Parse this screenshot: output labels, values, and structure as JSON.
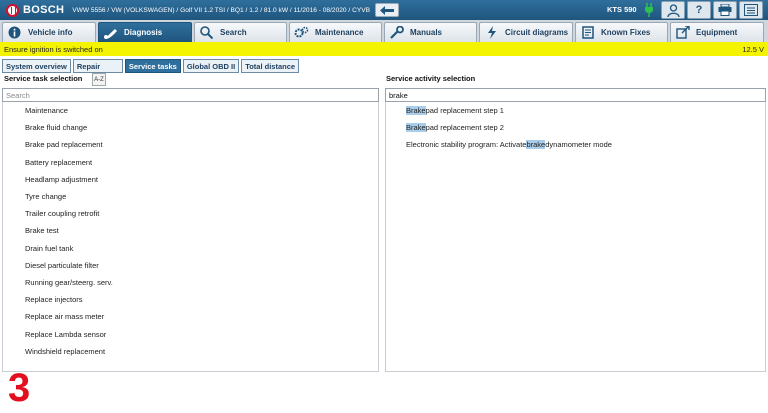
{
  "header": {
    "brand": "BOSCH",
    "vehicle_info": "VWW 5556 / VW (VOLKSWAGEN) / Golf VII 1.2 TSI / BQ1 / 1.2 / 81.0 kW / 11/2016 - 08/2020 / CYVB",
    "device": "KTS 590",
    "back_icon": "back-arrow-icon",
    "action_icons": [
      "user-icon",
      "help-icon",
      "print-icon",
      "menu-icon"
    ],
    "help_glyph": "?"
  },
  "nav": {
    "tabs": [
      {
        "label": "Vehicle info",
        "icon": "info-icon"
      },
      {
        "label": "Diagnosis",
        "icon": "stethoscope-icon",
        "active": true
      },
      {
        "label": "Search",
        "icon": "search-icon"
      },
      {
        "label": "Maintenance",
        "icon": "gears-icon"
      },
      {
        "label": "Manuals",
        "icon": "wrench-icon"
      },
      {
        "label": "Circuit diagrams",
        "icon": "lightning-icon"
      },
      {
        "label": "Known Fixes",
        "icon": "book-icon"
      },
      {
        "label": "Equipment",
        "icon": "external-icon"
      }
    ]
  },
  "status": {
    "message": "Ensure ignition is switched on",
    "voltage": "12.5 V"
  },
  "subtabs": [
    {
      "label": "System overview"
    },
    {
      "label": "Repair"
    },
    {
      "label": "Service tasks",
      "active": true
    },
    {
      "label": "Global OBD II"
    },
    {
      "label": "Total distance"
    }
  ],
  "left_panel": {
    "title": "Service task selection",
    "sort_label": "A-Z",
    "search_placeholder": "Search",
    "items": [
      "Maintenance",
      "Brake fluid change",
      "Brake pad replacement",
      "Battery replacement",
      "Headlamp adjustment",
      "Tyre change",
      "Trailer coupling retrofit",
      "Brake test",
      "Drain fuel tank",
      "Diesel particulate filter",
      "Running gear/steerg. serv.",
      "Replace injectors",
      "Replace air mass meter",
      "Replace Lambda sensor",
      "Windshield replacement"
    ]
  },
  "right_panel": {
    "title": "Service activity selection",
    "search_value": "brake",
    "results": [
      {
        "before": "",
        "match": "Brake",
        "after": " pad replacement step 1"
      },
      {
        "before": "",
        "match": "Brake",
        "after": " pad replacement step 2"
      },
      {
        "before": "Electronic stability program: Activate ",
        "match": "brake",
        "after": " dynamometer mode"
      }
    ]
  },
  "overlay": {
    "number": "3"
  },
  "colors": {
    "header_blue": "#1f557d",
    "status_yellow": "#f4f400",
    "highlight": "#a9cdea",
    "overlay_red": "#e2101e"
  }
}
